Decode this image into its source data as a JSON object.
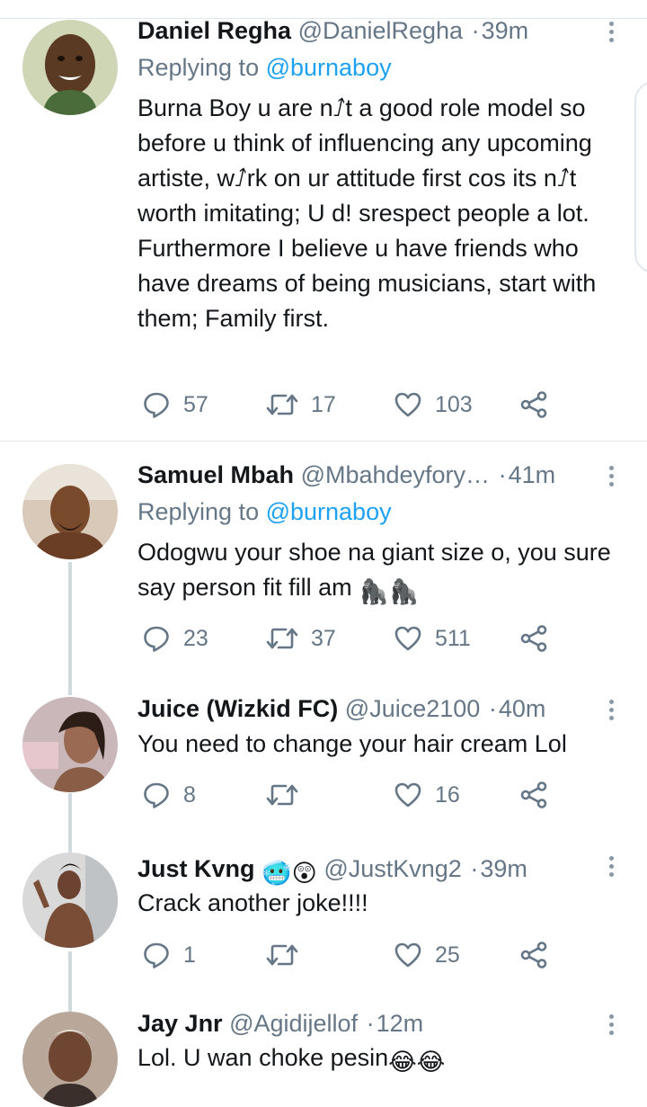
{
  "tweets": [
    {
      "name": "Daniel Regha",
      "handle": "@DanielRegha",
      "time": "39m",
      "replying_label": "Replying to ",
      "replying_to": "@burnaboy",
      "text": "Burna Boy u are n⭜t a good role model so before u think of influencing any upcoming artiste, w⭜rk on ur attitude first cos its n⭜t worth imitating; U d! srespect people a lot. Furthermore I believe u have friends who have dreams of being musicians, start with them; Family first.",
      "replies": "57",
      "retweets": "17",
      "likes": "103"
    },
    {
      "name": "Samuel Mbah",
      "handle": "@Mbahdeyfory…",
      "time": "41m",
      "replying_label": "Replying to ",
      "replying_to": "@burnaboy",
      "text": "Odogwu your shoe na giant size o, you sure say person fit fill am ",
      "text_emoji": "🦍🦍",
      "replies": "23",
      "retweets": "37",
      "likes": "511"
    },
    {
      "name": "Juice (Wizkid FC)",
      "handle": "@Juice2100",
      "time": "40m",
      "text": "You need to change your hair cream Lol",
      "replies": "8",
      "retweets": "",
      "likes": "16"
    },
    {
      "name": "Just Kvng ",
      "name_emoji": "🥶😲",
      "handle": "@JustKvng2",
      "time": "39m",
      "text": "Crack another joke!!!!",
      "replies": "1",
      "retweets": "",
      "likes": "25"
    },
    {
      "name": "Jay Jnr",
      "handle": "@Agidijellof",
      "time": "12m",
      "text": "Lol. U wan choke pesin",
      "text_emoji": "😂😂"
    }
  ],
  "icons": {
    "reply": "reply-icon",
    "retweet": "retweet-icon",
    "like": "heart-icon",
    "share": "share-icon",
    "more": "more-vertical-icon"
  },
  "colors": {
    "link": "#1da1f2",
    "muted": "#657786",
    "text": "#14171a",
    "divider": "#e1e8ed"
  }
}
